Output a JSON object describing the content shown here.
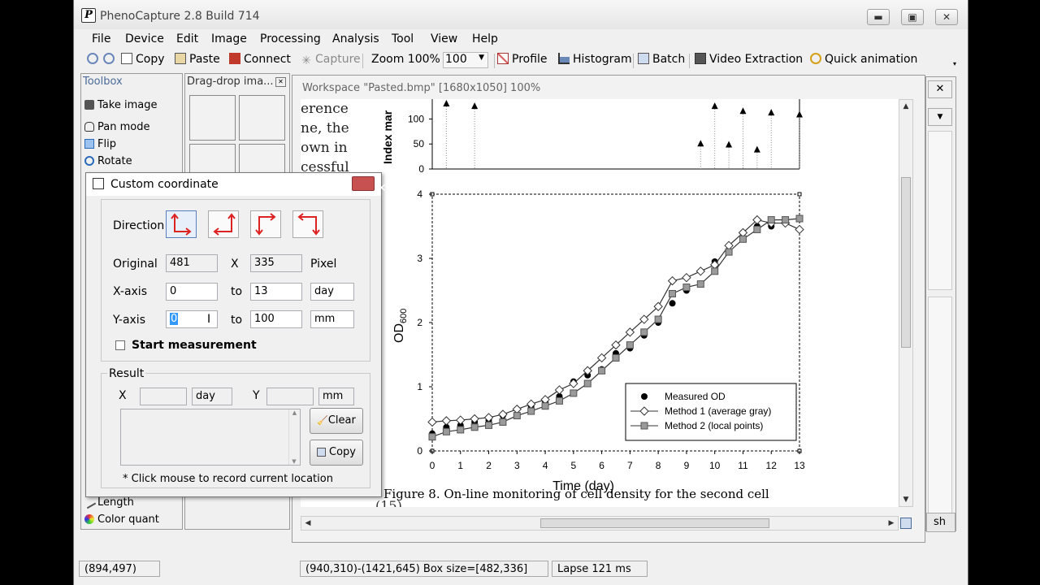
{
  "window": {
    "title": "PhenoCapture 2.8   Build 714",
    "icon_letter": "P"
  },
  "window_controls": {
    "minimize": "▬",
    "maximize": "▣",
    "close": "✕"
  },
  "menu": [
    "File",
    "Device",
    "Edit",
    "Image",
    "Processing",
    "Analysis",
    "Tool",
    "View",
    "Help"
  ],
  "toolbar": {
    "copy": "Copy",
    "paste": "Paste",
    "connect": "Connect",
    "capture": "Capture",
    "zoom_label": "Zoom 100%",
    "zoom_value": "100",
    "profile": "Profile",
    "histogram": "Histogram",
    "batch": "Batch",
    "video": "Video Extraction",
    "quick": "Quick animation"
  },
  "toolbox": {
    "title": "Toolbox",
    "items": [
      "Take image",
      "Pan mode",
      "Flip",
      "Rotate"
    ],
    "bottom_items": [
      "Length",
      "Color quant"
    ]
  },
  "dragdrop": {
    "title": "Drag-drop ima..."
  },
  "workspace": {
    "title": "Workspace \"Pasted.bmp\"   [1680x1050]   100%",
    "doc_text": [
      "erence",
      "ne, the",
      "own in",
      "cessful"
    ],
    "figure_caption": "Figure 8.  On-line monitoring of cell density for the second cell",
    "figure_footnote": "(15)",
    "right_panel_text": "sh"
  },
  "chart_data": [
    {
      "type": "scatter",
      "ylabel": "Index mar",
      "yticks": [
        "100",
        "50",
        "0"
      ],
      "ylim": [
        0,
        130
      ],
      "series": [
        {
          "marker": "triangle",
          "points": [
            [
              0.5,
              130
            ],
            [
              1.5,
              125
            ],
            [
              9.5,
              50
            ],
            [
              10,
              125
            ],
            [
              10.5,
              48
            ],
            [
              11,
              115
            ],
            [
              11.5,
              38
            ],
            [
              12,
              112
            ],
            [
              13,
              108
            ]
          ]
        }
      ]
    },
    {
      "type": "line",
      "xlabel": "Time (day)",
      "ylabel": "OD600",
      "xlim": [
        0,
        13
      ],
      "ylim": [
        0,
        4
      ],
      "xticks": [
        "0",
        "1",
        "2",
        "3",
        "4",
        "5",
        "6",
        "7",
        "8",
        "9",
        "10",
        "11",
        "12",
        "13"
      ],
      "yticks": [
        "0",
        "1",
        "2",
        "3",
        "4"
      ],
      "legend_position": "bottom-right",
      "series": [
        {
          "name": "Measured OD",
          "marker": "circle",
          "x": [
            0,
            0.5,
            1,
            1.5,
            2,
            2.5,
            3,
            3.5,
            4,
            4.5,
            5,
            5.5,
            6,
            6.5,
            7,
            7.5,
            8,
            8.5,
            9,
            9.5,
            10,
            10.5,
            11,
            11.5,
            12
          ],
          "y": [
            0.27,
            0.37,
            0.4,
            0.45,
            0.48,
            0.55,
            0.65,
            0.7,
            0.77,
            0.85,
            1.08,
            1.18,
            1.27,
            1.52,
            1.6,
            1.8,
            2.0,
            2.3,
            2.5,
            2.6,
            2.95,
            3.1,
            3.4,
            3.5,
            3.5
          ]
        },
        {
          "name": "Method 1 (average gray)",
          "marker": "diamond",
          "x": [
            0,
            0.5,
            1,
            1.5,
            2,
            2.5,
            3,
            3.5,
            4,
            4.5,
            5,
            5.5,
            6,
            6.5,
            7,
            7.5,
            8,
            8.5,
            9,
            9.5,
            10,
            10.5,
            11,
            11.5,
            12,
            12.5,
            13
          ],
          "y": [
            0.45,
            0.47,
            0.48,
            0.5,
            0.52,
            0.57,
            0.65,
            0.73,
            0.8,
            0.95,
            1.05,
            1.25,
            1.45,
            1.65,
            1.85,
            2.05,
            2.25,
            2.65,
            2.7,
            2.8,
            2.9,
            3.2,
            3.4,
            3.6,
            3.55,
            3.55,
            3.45
          ]
        },
        {
          "name": "Method 2 (local points)",
          "marker": "square",
          "x": [
            0,
            0.5,
            1,
            1.5,
            2,
            2.5,
            3,
            3.5,
            4,
            4.5,
            5,
            5.5,
            6,
            6.5,
            7,
            7.5,
            8,
            8.5,
            9,
            9.5,
            10,
            10.5,
            11,
            11.5,
            12,
            12.5,
            13
          ],
          "y": [
            0.22,
            0.3,
            0.33,
            0.37,
            0.4,
            0.45,
            0.55,
            0.62,
            0.7,
            0.78,
            0.9,
            1.05,
            1.25,
            1.45,
            1.65,
            1.85,
            2.05,
            2.45,
            2.55,
            2.6,
            2.8,
            3.1,
            3.3,
            3.45,
            3.6,
            3.6,
            3.62
          ]
        }
      ]
    }
  ],
  "dialog": {
    "title": "Custom coordinate",
    "direction_label": "Direction",
    "original_label": "Original",
    "original_x": "481",
    "x_sep": "X",
    "original_y": "335",
    "original_unit": "Pixel",
    "xaxis_label": "X-axis",
    "xaxis_from": "0",
    "to1": "to",
    "xaxis_to": "13",
    "xaxis_unit": "day",
    "yaxis_label": "Y-axis",
    "yaxis_from": "0",
    "to2": "to",
    "yaxis_to": "100",
    "yaxis_unit": "mm",
    "start_measurement": "Start measurement",
    "result_label": "Result",
    "result_x_label": "X",
    "result_x": "",
    "result_x_unit": "day",
    "result_y_label": "Y",
    "result_y": "",
    "result_y_unit": "mm",
    "clear": "Clear",
    "copy": "Copy",
    "hint": "* Click mouse to record current location"
  },
  "status": {
    "pos": "(894,497)",
    "box": "(940,310)-(1421,645)   Box size=[482,336]",
    "lapse": "Lapse 121 ms"
  }
}
